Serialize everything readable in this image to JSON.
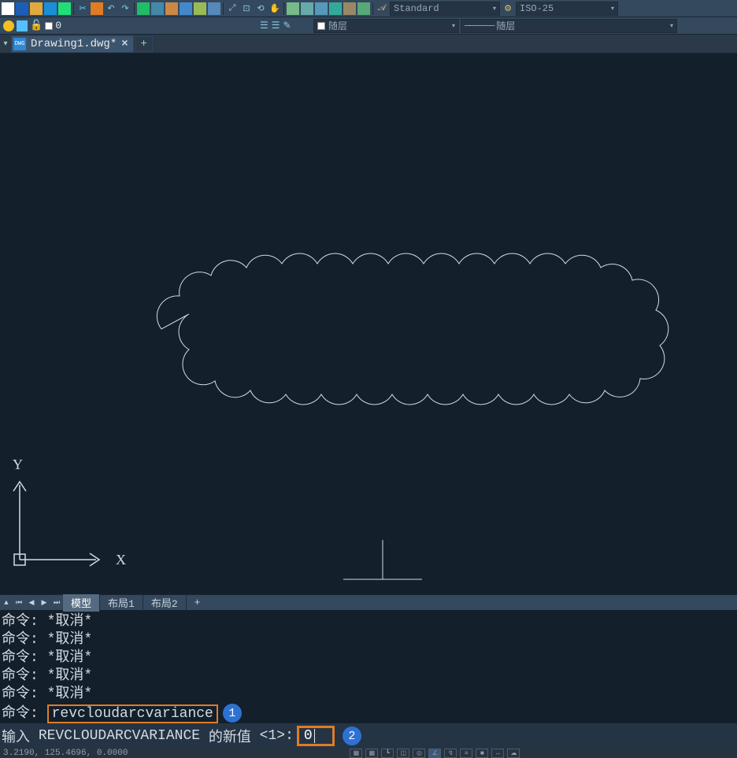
{
  "toolbar1": {
    "text_style_value": "Standard",
    "dim_style_value": "ISO-25"
  },
  "toolbar2": {
    "layer_name": "0",
    "color_select": "随层",
    "linetype_select": "随层"
  },
  "tabs": {
    "active_file": "Drawing1.dwg*",
    "close_glyph": "×",
    "new_glyph": "+"
  },
  "canvas": {
    "axis_x_label": "X",
    "axis_y_label": "Y"
  },
  "layout_tabs": {
    "model": "模型",
    "layout1": "布局1",
    "layout2": "布局2",
    "add": "+"
  },
  "cmd_history": {
    "label": "命令:",
    "cancel": "*取消*",
    "typed_command": "revcloudarcvariance",
    "callout1": "1"
  },
  "cmd_prompt": {
    "prefix": "输入",
    "var_name": "REVCLOUDARCVARIANCE",
    "mid": "的新值",
    "default": "<1>:",
    "input_value": "0",
    "callout2": "2"
  },
  "status": {
    "coords": "3.2190, 125.4696, 0.0000"
  },
  "chart_data": null
}
